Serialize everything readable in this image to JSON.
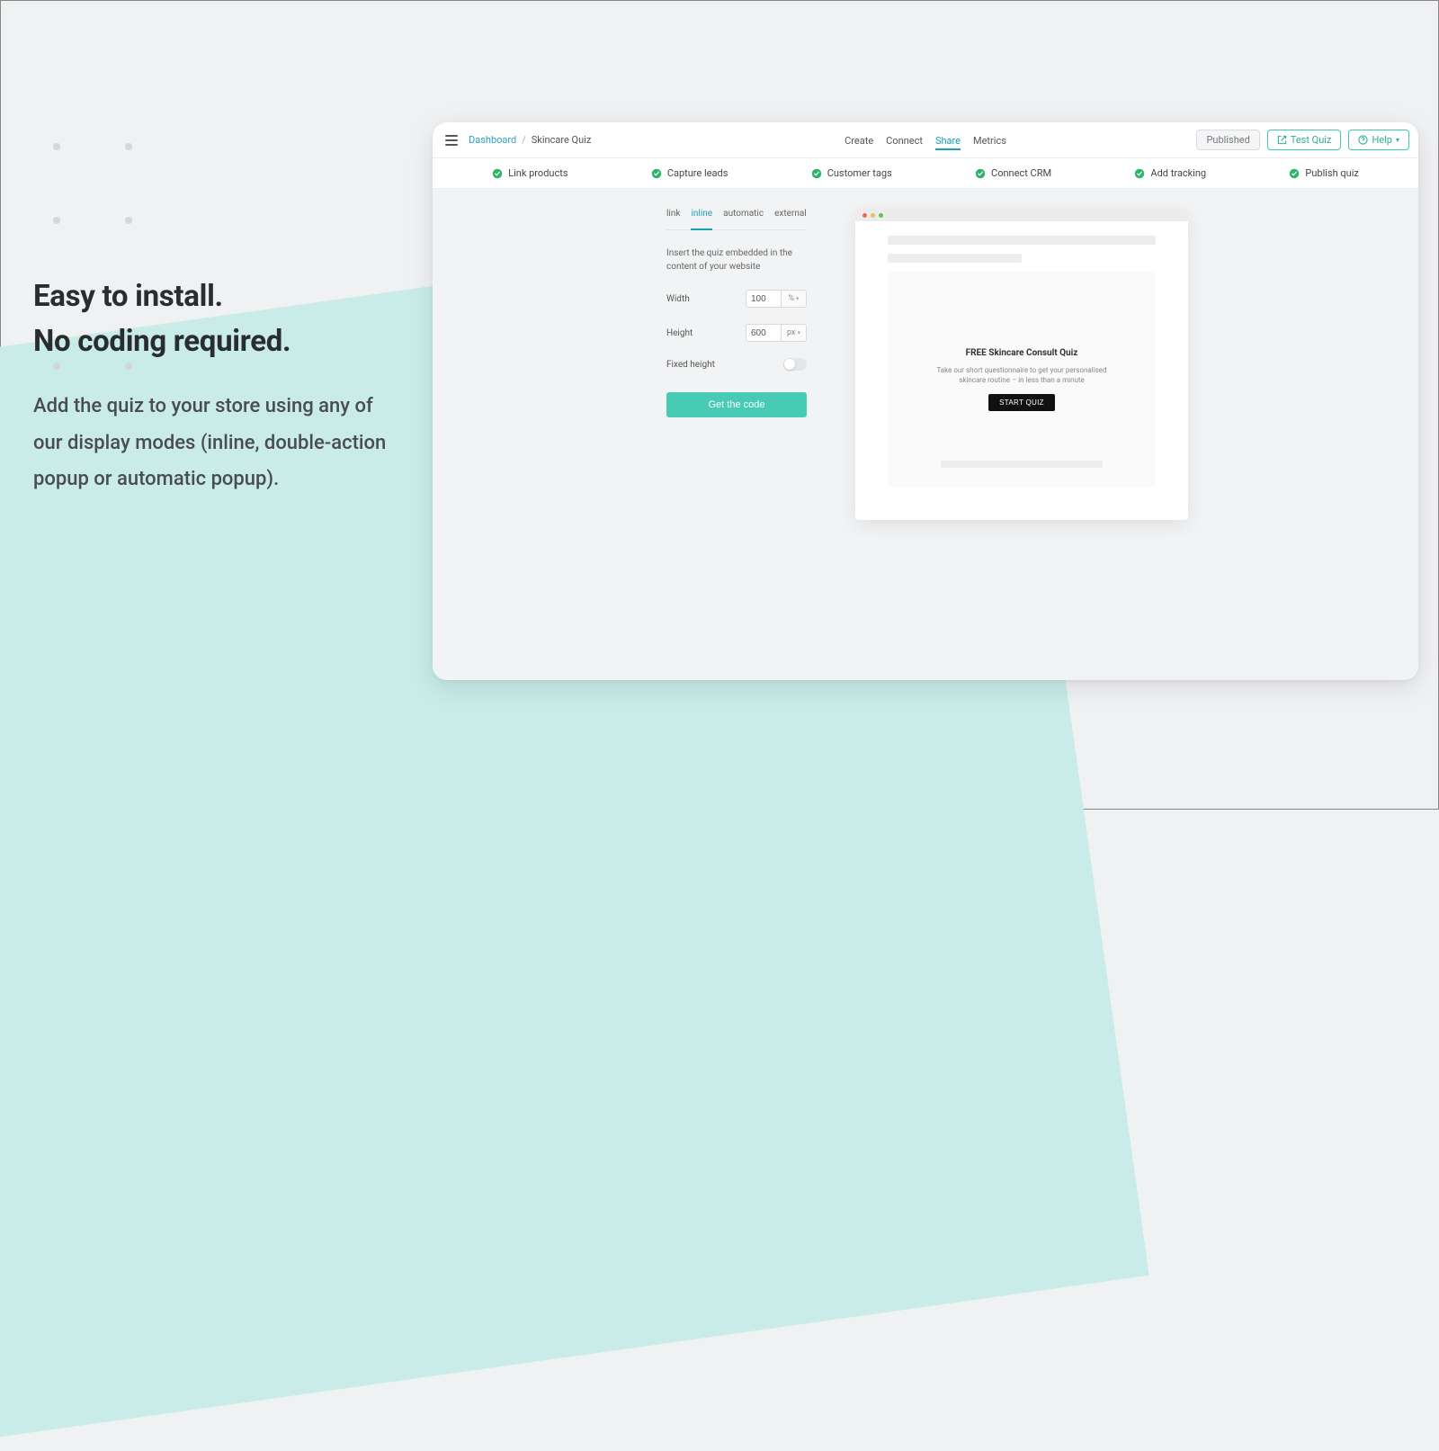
{
  "promo": {
    "heading_line1": "Easy to install.",
    "heading_line2": "No coding required.",
    "body": "Add the quiz to your store using any of our display modes (inline, double-action popup or automatic popup)."
  },
  "breadcrumb": {
    "root": "Dashboard",
    "current": "Skincare Quiz"
  },
  "nav_tabs": {
    "create": "Create",
    "connect": "Connect",
    "share": "Share",
    "metrics": "Metrics"
  },
  "top_actions": {
    "status": "Published",
    "test": "Test Quiz",
    "help": "Help"
  },
  "steps": {
    "link_products": "Link products",
    "capture_leads": "Capture leads",
    "customer_tags": "Customer tags",
    "connect_crm": "Connect CRM",
    "add_tracking": "Add tracking",
    "publish_quiz": "Publish quiz"
  },
  "share_tabs": {
    "link": "link",
    "inline": "inline",
    "automatic": "automatic",
    "external": "external"
  },
  "form": {
    "description": "Insert the quiz embedded in the content of your website",
    "width_label": "Width",
    "width_value": "100",
    "width_unit": "%",
    "height_label": "Height",
    "height_value": "600",
    "height_unit": "px",
    "fixed_height_label": "Fixed height",
    "get_code": "Get the code"
  },
  "preview": {
    "title": "FREE Skincare Consult Quiz",
    "subtitle": "Take our short questionnaire to get your personalised skincare routine – in less than a minute",
    "cta": "START QUIZ"
  }
}
